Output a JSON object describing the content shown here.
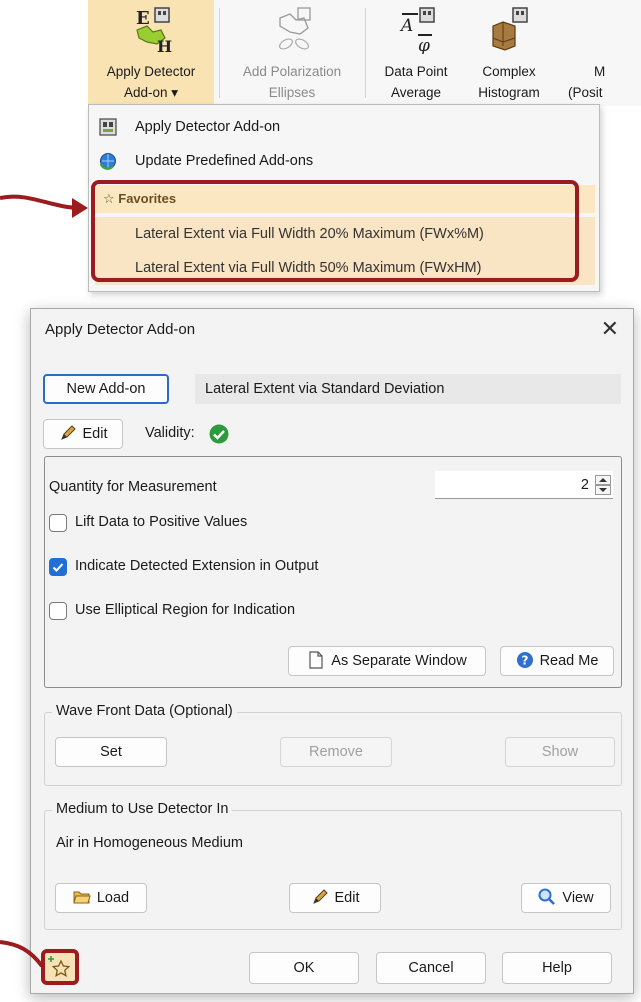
{
  "ribbon": {
    "buttons": [
      {
        "line1": "Apply Detector",
        "line2": "Add-on ▾"
      },
      {
        "line1": "Add Polarization",
        "line2": "Ellipses"
      },
      {
        "line1": "Data Point",
        "line2": "Average"
      },
      {
        "line1": "Complex",
        "line2": "Histogram"
      },
      {
        "line1": "M",
        "line2": "(Posit"
      }
    ]
  },
  "menu": {
    "items": [
      {
        "label": "Apply Detector Add-on"
      },
      {
        "label": "Update Predefined Add-ons"
      }
    ],
    "favorites_header": "☆ Favorites",
    "favorites": [
      "Lateral Extent via Full Width 20% Maximum (FWx%M)",
      "Lateral Extent via Full Width 50% Maximum (FWxHM)"
    ]
  },
  "dialog": {
    "title": "Apply Detector Add-on",
    "close_glyph": "✕",
    "new_addon_label": "New Add-on",
    "addon_name": "Lateral Extent via Standard Deviation",
    "edit_label": "Edit",
    "validity_label": "Validity:",
    "quantity_label": "Quantity for Measurement",
    "quantity_value": "2",
    "checkboxes": [
      {
        "label": "Lift Data to Positive Values",
        "checked": false
      },
      {
        "label": "Indicate Detected Extension in Output",
        "checked": true
      },
      {
        "label": "Use Elliptical Region for Indication",
        "checked": false
      }
    ],
    "separate_window_label": "As Separate Window",
    "read_me_label": "Read Me",
    "wavefront": {
      "title": "Wave Front Data (Optional)",
      "set": "Set",
      "remove": "Remove",
      "show": "Show"
    },
    "medium": {
      "title": "Medium to Use Detector In",
      "value": "Air in Homogeneous Medium",
      "load": "Load",
      "edit": "Edit",
      "view": "View"
    },
    "ok": "OK",
    "cancel": "Cancel",
    "help": "Help"
  },
  "colors": {
    "accent_red": "#9b1b1f",
    "highlight": "#fae3b3",
    "check_blue": "#1f6fd6",
    "valid_green": "#2e9a3e"
  }
}
